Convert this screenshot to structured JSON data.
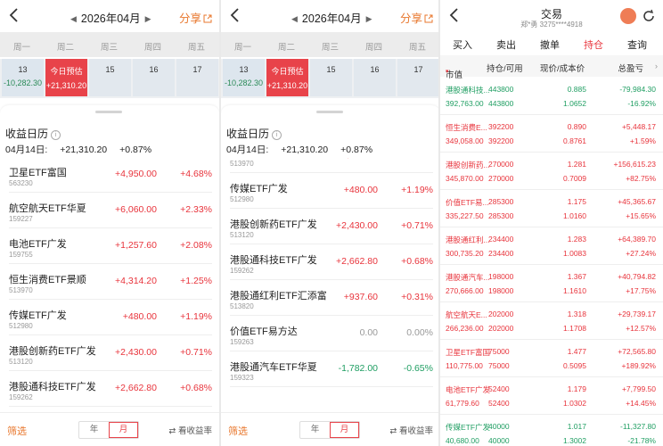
{
  "calendar": {
    "month": "2026年04月",
    "share_label": "分享",
    "weekdays": [
      "周一",
      "周二",
      "周三",
      "周四",
      "周五"
    ],
    "days": [
      {
        "day": "13",
        "value": "-10,282.30"
      },
      {
        "day": "今日预估",
        "value": "+21,310.20"
      },
      {
        "day": "15",
        "value": ""
      },
      {
        "day": "16",
        "value": ""
      },
      {
        "day": "17",
        "value": ""
      }
    ],
    "sheet_title": "收益日历",
    "summary_date": "04月14日:",
    "summary_amount": "+21,310.20",
    "summary_pct": "+0.87%",
    "filter_label": "筛选",
    "period_year": "年",
    "period_month": "月",
    "yield_label": "看收益率"
  },
  "list_left": [
    {
      "name": "卫星ETF富国",
      "code": "563230",
      "amount": "+4,950.00",
      "pct": "+4.68%",
      "color": "#e8343c"
    },
    {
      "name": "航空航天ETF华夏",
      "code": "159227",
      "amount": "+6,060.00",
      "pct": "+2.33%",
      "color": "#e8343c"
    },
    {
      "name": "电池ETF广发",
      "code": "159755",
      "amount": "+1,257.60",
      "pct": "+2.08%",
      "color": "#e8343c"
    },
    {
      "name": "恒生消费ETF景顺",
      "code": "513970",
      "amount": "+4,314.20",
      "pct": "+1.25%",
      "color": "#e8343c"
    },
    {
      "name": "传媒ETF广发",
      "code": "512980",
      "amount": "+480.00",
      "pct": "+1.19%",
      "color": "#e8343c"
    },
    {
      "name": "港股创新药ETF广发",
      "code": "513120",
      "amount": "+2,430.00",
      "pct": "+0.71%",
      "color": "#e8343c"
    },
    {
      "name": "港股通科技ETF广发",
      "code": "159262",
      "amount": "+2,662.80",
      "pct": "+0.68%",
      "color": "#e8343c"
    }
  ],
  "list_right": [
    {
      "name": "恒生消费ETF景顺",
      "code": "513970",
      "amount": "+4,314.20",
      "pct": "+1.25%",
      "color": "#e8343c"
    },
    {
      "name": "传媒ETF广发",
      "code": "512980",
      "amount": "+480.00",
      "pct": "+1.19%",
      "color": "#e8343c"
    },
    {
      "name": "港股创新药ETF广发",
      "code": "513120",
      "amount": "+2,430.00",
      "pct": "+0.71%",
      "color": "#e8343c"
    },
    {
      "name": "港股通科技ETF广发",
      "code": "159262",
      "amount": "+2,662.80",
      "pct": "+0.68%",
      "color": "#e8343c"
    },
    {
      "name": "港股通红利ETF汇添富",
      "code": "513820",
      "amount": "+937.60",
      "pct": "+0.31%",
      "color": "#e8343c"
    },
    {
      "name": "价值ETF易方达",
      "code": "159263",
      "amount": "0.00",
      "pct": "0.00%",
      "color": "#999999"
    },
    {
      "name": "港股通汽车ETF华夏",
      "code": "159323",
      "amount": "-1,782.00",
      "pct": "-0.65%",
      "color": "#1f9e62"
    }
  ],
  "trade": {
    "title": "交易",
    "account": "郑*勇 3275****4918",
    "tabs": [
      "买入",
      "卖出",
      "撤单",
      "持仓",
      "查询"
    ],
    "active_tab": 3,
    "columns": [
      "市值",
      "持仓/可用",
      "现价/成本价",
      "总盈亏"
    ],
    "holdings": [
      {
        "name": "港股通科技...",
        "value": "392,763.00",
        "pos": "443800",
        "avail": "443800",
        "price": "0.885",
        "cost": "1.0652",
        "pl": "-79,984.30",
        "plpct": "-16.92%",
        "color": "#1f9e62"
      },
      {
        "name": "恒生消费E...",
        "value": "349,058.00",
        "pos": "392200",
        "avail": "392200",
        "price": "0.890",
        "cost": "0.8761",
        "pl": "+5,448.17",
        "plpct": "+1.59%",
        "color": "#e8343c"
      },
      {
        "name": "港股创新药...",
        "value": "345,870.00",
        "pos": "270000",
        "avail": "270000",
        "price": "1.281",
        "cost": "0.7009",
        "pl": "+156,615.23",
        "plpct": "+82.75%",
        "color": "#e8343c"
      },
      {
        "name": "价值ETF易...",
        "value": "335,227.50",
        "pos": "285300",
        "avail": "285300",
        "price": "1.175",
        "cost": "1.0160",
        "pl": "+45,365.67",
        "plpct": "+15.65%",
        "color": "#e8343c"
      },
      {
        "name": "港股通红利...",
        "value": "300,735.20",
        "pos": "234400",
        "avail": "234400",
        "price": "1.283",
        "cost": "1.0083",
        "pl": "+64,389.70",
        "plpct": "+27.24%",
        "color": "#e8343c"
      },
      {
        "name": "港股通汽车...",
        "value": "270,666.00",
        "pos": "198000",
        "avail": "198000",
        "price": "1.367",
        "cost": "1.1610",
        "pl": "+40,794.82",
        "plpct": "+17.75%",
        "color": "#e8343c"
      },
      {
        "name": "航空航天E...",
        "value": "266,236.00",
        "pos": "202000",
        "avail": "202000",
        "price": "1.318",
        "cost": "1.1708",
        "pl": "+29,739.17",
        "plpct": "+12.57%",
        "color": "#e8343c"
      },
      {
        "name": "卫星ETF富国",
        "value": "110,775.00",
        "pos": "75000",
        "avail": "75000",
        "price": "1.477",
        "cost": "0.5095",
        "pl": "+72,565.80",
        "plpct": "+189.92%",
        "color": "#e8343c"
      },
      {
        "name": "电池ETF广发",
        "value": "61,779.60",
        "pos": "52400",
        "avail": "52400",
        "price": "1.179",
        "cost": "1.0302",
        "pl": "+7,799.50",
        "plpct": "+14.45%",
        "color": "#e8343c"
      },
      {
        "name": "传媒ETF广发",
        "value": "40,680.00",
        "pos": "40000",
        "avail": "40000",
        "price": "1.017",
        "cost": "1.3002",
        "pl": "-11,327.80",
        "plpct": "-21.78%",
        "color": "#1f9e62"
      }
    ]
  }
}
